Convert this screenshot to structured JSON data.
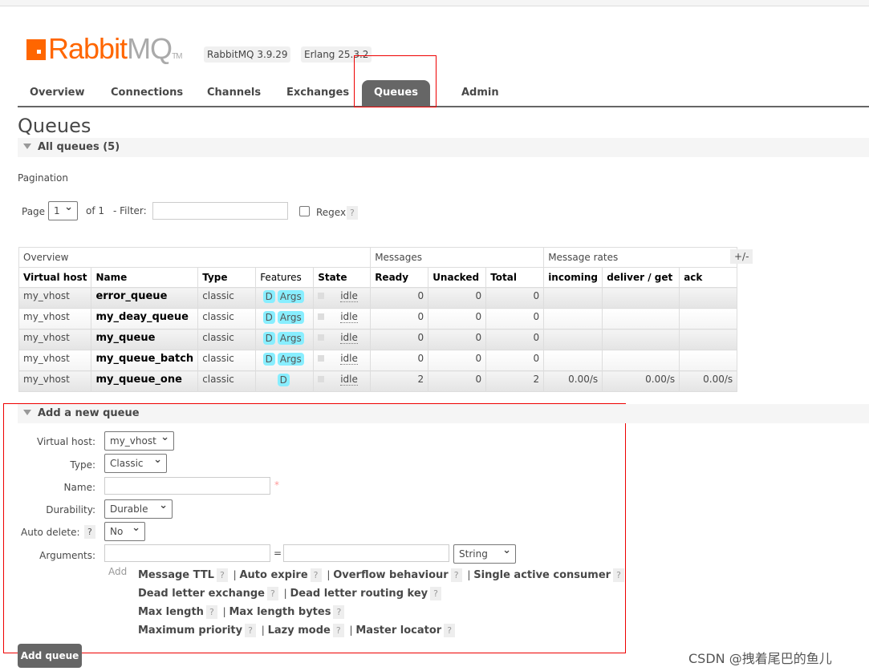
{
  "header": {
    "logo_text": "RabbitMQ",
    "logo_tm": "TM",
    "version": "RabbitMQ 3.9.29",
    "erlang": "Erlang 25.3.2"
  },
  "nav": [
    "Overview",
    "Connections",
    "Channels",
    "Exchanges",
    "Queues",
    "Admin"
  ],
  "page_title": "Queues",
  "all_queues": "All queues (5)",
  "pagination": {
    "label": "Pagination",
    "page_label": "Page",
    "page_value": "1",
    "of": "of 1",
    "filter_label": "- Filter:",
    "regex": "Regex",
    "help": "?"
  },
  "table": {
    "groups": [
      "Overview",
      "Messages",
      "Message rates"
    ],
    "toggle": "+/-",
    "columns": [
      "Virtual host",
      "Name",
      "Type",
      "Features",
      "State",
      "Ready",
      "Unacked",
      "Total",
      "incoming",
      "deliver / get",
      "ack"
    ],
    "rows": [
      {
        "vhost": "my_vhost",
        "name": "error_queue",
        "type": "classic",
        "features": [
          "D",
          "Args"
        ],
        "state": "idle",
        "ready": "0",
        "unacked": "0",
        "total": "0",
        "incoming": "",
        "deliver": "",
        "ack": ""
      },
      {
        "vhost": "my_vhost",
        "name": "my_deay_queue",
        "type": "classic",
        "features": [
          "D",
          "Args"
        ],
        "state": "idle",
        "ready": "0",
        "unacked": "0",
        "total": "0",
        "incoming": "",
        "deliver": "",
        "ack": ""
      },
      {
        "vhost": "my_vhost",
        "name": "my_queue",
        "type": "classic",
        "features": [
          "D",
          "Args"
        ],
        "state": "idle",
        "ready": "0",
        "unacked": "0",
        "total": "0",
        "incoming": "",
        "deliver": "",
        "ack": ""
      },
      {
        "vhost": "my_vhost",
        "name": "my_queue_batch",
        "type": "classic",
        "features": [
          "D",
          "Args"
        ],
        "state": "idle",
        "ready": "0",
        "unacked": "0",
        "total": "0",
        "incoming": "",
        "deliver": "",
        "ack": ""
      },
      {
        "vhost": "my_vhost",
        "name": "my_queue_one",
        "type": "classic",
        "features": [
          "D"
        ],
        "state": "idle",
        "ready": "2",
        "unacked": "0",
        "total": "2",
        "incoming": "0.00/s",
        "deliver": "0.00/s",
        "ack": "0.00/s"
      }
    ]
  },
  "add": {
    "title": "Add a new queue",
    "vhost_label": "Virtual host:",
    "vhost": "my_vhost",
    "type_label": "Type:",
    "type": "Classic",
    "name_label": "Name:",
    "name_value": "",
    "required": "*",
    "durability_label": "Durability:",
    "durability": "Durable",
    "autodelete_label": "Auto delete:",
    "autodelete": "No",
    "arguments_label": "Arguments:",
    "eq": "=",
    "arg_type": "String",
    "add_label": "Add",
    "arg_lines": [
      [
        "Message TTL",
        "Auto expire",
        "Overflow behaviour",
        "Single active consumer"
      ],
      [
        "Dead letter exchange",
        "Dead letter routing key"
      ],
      [
        "Max length",
        "Max length bytes"
      ],
      [
        "Maximum priority",
        "Lazy mode",
        "Master locator"
      ]
    ],
    "submit": "Add queue"
  },
  "watermark": "CSDN @拽着尾巴的鱼儿",
  "colors": {
    "brand": "#ff6600",
    "tab_active": "#666666",
    "badge": "#88eeff",
    "highlight": "#ee0000"
  }
}
